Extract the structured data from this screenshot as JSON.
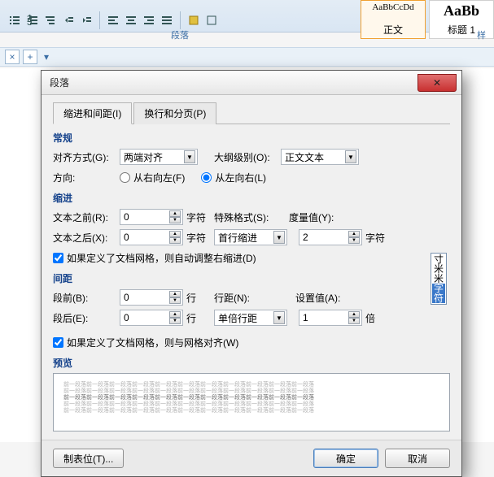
{
  "ribbon": {
    "paragraph_group": "段落",
    "styles_group": "样",
    "style_normal_sample": "AaBbCcDd",
    "style_normal_name": "正文",
    "style_h1_sample": "AaBb",
    "style_h1_name": "标题 1"
  },
  "tabrow": {
    "close": "×",
    "add": "+"
  },
  "dialog": {
    "title": "段落",
    "tab1": "缩进和间距(I)",
    "tab2": "换行和分页(P)",
    "general_title": "常规",
    "alignment_label": "对齐方式(G):",
    "alignment_value": "两端对齐",
    "outline_label": "大纲级别(O):",
    "outline_value": "正文文本",
    "direction_label": "方向:",
    "dir_rtl": "从右向左(F)",
    "dir_ltr": "从左向右(L)",
    "indent_title": "缩进",
    "text_before_label": "文本之前(R):",
    "text_before_value": "0",
    "text_after_label": "文本之后(X):",
    "text_after_value": "0",
    "char_unit": "字符",
    "special_label": "特殊格式(S):",
    "special_value": "首行缩进",
    "measure_label": "度量值(Y):",
    "measure_value": "2",
    "measure_unit": "字符",
    "auto_indent_check": "如果定义了文档网格，则自动调整右缩进(D)",
    "spacing_title": "间距",
    "before_label": "段前(B):",
    "before_value": "0",
    "after_label": "段后(E):",
    "after_value": "0",
    "line_unit": "行",
    "linespacing_label": "行距(N):",
    "linespacing_value": "单倍行距",
    "setvalue_label": "设置值(A):",
    "setvalue_value": "1",
    "bei_unit": "倍",
    "grid_align_check": "如果定义了文档网格，则与网格对齐(W)",
    "preview_title": "预览",
    "preview_line": "前一段落前一段落前一段落前一段落前一段落前一段落前一段落前一段落前一段落前一段落前一段落",
    "unit_options": {
      "cun": "寸",
      "mm": "米米",
      "ch": "字符"
    },
    "btn_tabs": "制表位(T)...",
    "btn_ok": "确定",
    "btn_cancel": "取消"
  }
}
